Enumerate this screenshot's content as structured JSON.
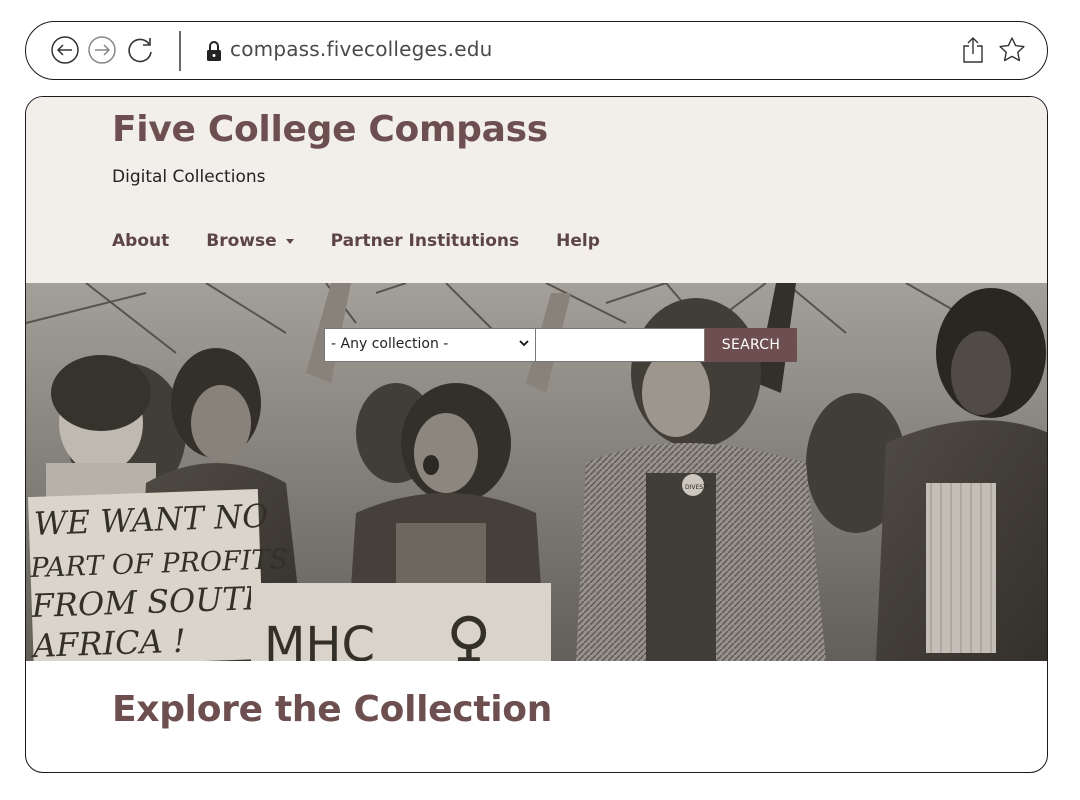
{
  "browser": {
    "url": "compass.fivecolleges.edu"
  },
  "header": {
    "title": "Five College Compass",
    "subtitle": "Digital Collections"
  },
  "nav": {
    "items": [
      {
        "label": "About"
      },
      {
        "label": "Browse",
        "has_dropdown": true
      },
      {
        "label": "Partner Institutions"
      },
      {
        "label": "Help"
      }
    ]
  },
  "search": {
    "collection_selected": "- Any collection -",
    "query_value": "",
    "button_label": "SEARCH"
  },
  "hero": {
    "signs": [
      "WE WANT NO",
      "PART OF PROFITS",
      "FROM SOUTH",
      "AFRICA !",
      "MHC",
      "♀",
      "DIVEST!"
    ]
  },
  "main": {
    "section_title": "Explore the Collection"
  },
  "colors": {
    "brand": "#6e4f4f",
    "header_bg": "#f2efea",
    "nav_text": "#5e4545"
  },
  "icons": [
    "back-icon",
    "forward-icon",
    "reload-icon",
    "lock-icon",
    "share-icon",
    "star-icon",
    "chevron-down-icon"
  ]
}
